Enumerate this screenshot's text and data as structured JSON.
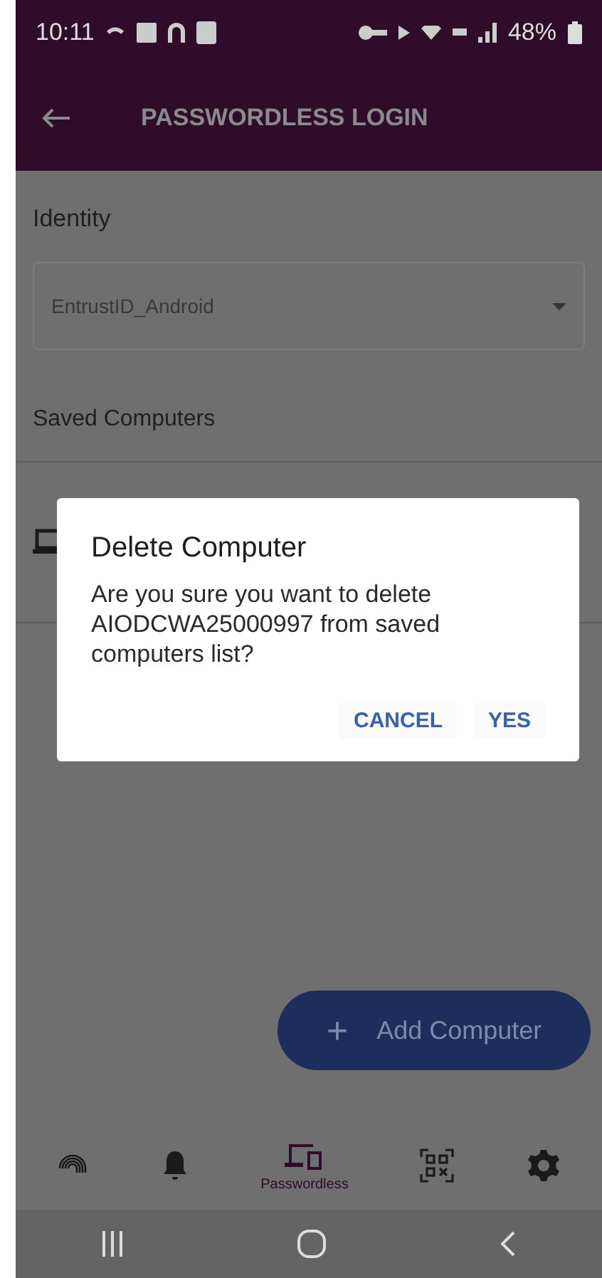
{
  "status_bar": {
    "time": "10:11",
    "battery": "48%"
  },
  "app_bar": {
    "title": "PASSWORDLESS LOGIN"
  },
  "identity": {
    "label": "Identity",
    "value": "EntrustID_Android"
  },
  "saved_computers": {
    "label": "Saved Computers"
  },
  "dialog": {
    "title": "Delete Computer",
    "message": "Are you sure you want to delete AIODCWA25000997 from saved computers list?",
    "buttons": [
      "CANCEL",
      "YES"
    ]
  },
  "fab": {
    "icon": "+",
    "label": "Add Computer"
  },
  "bottom_nav": [
    {
      "kind": "fingerprint",
      "selected": false
    },
    {
      "kind": "bell",
      "selected": false
    },
    {
      "kind": "devices",
      "label": "Passwordless",
      "selected": true
    },
    {
      "kind": "qr",
      "selected": false
    },
    {
      "kind": "gear",
      "selected": false
    }
  ]
}
